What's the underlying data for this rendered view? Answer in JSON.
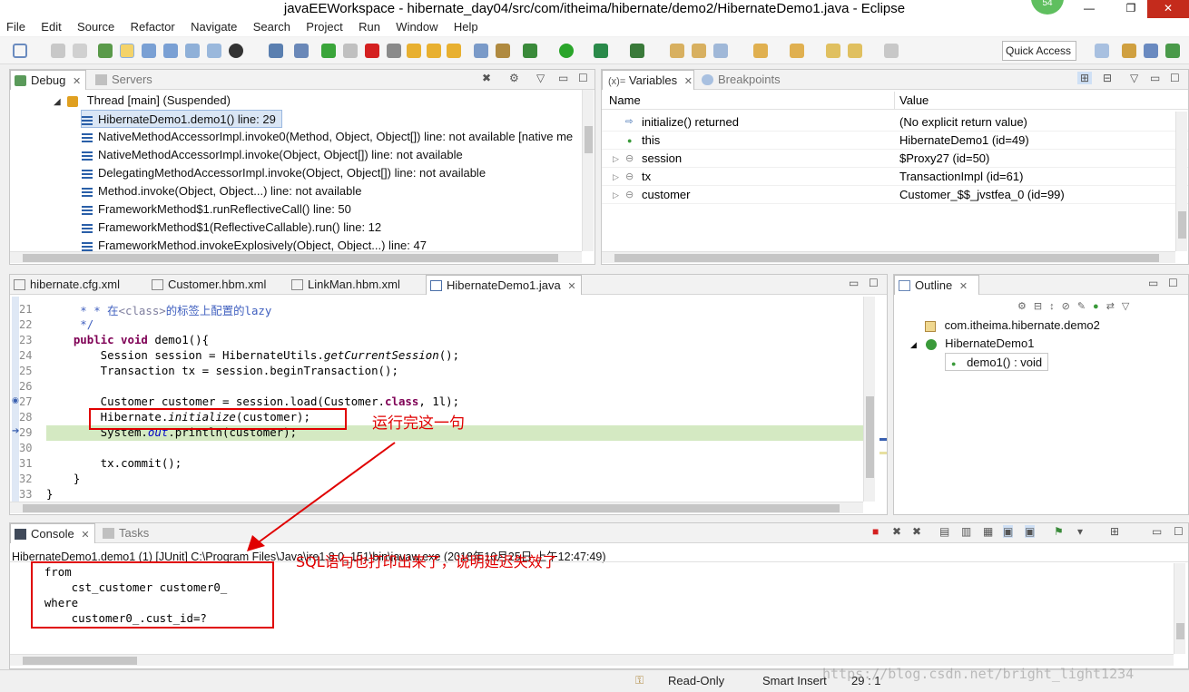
{
  "window": {
    "title": "javaEEWorkspace - hibernate_day04/src/com/itheima/hibernate/demo2/HibernateDemo1.java - Eclipse",
    "badge": "54",
    "minimize": "—",
    "restore": "❐",
    "close": "✕"
  },
  "menu": [
    "File",
    "Edit",
    "Source",
    "Refactor",
    "Navigate",
    "Search",
    "Project",
    "Run",
    "Window",
    "Help"
  ],
  "quick_access": {
    "label": "Quick Access"
  },
  "debug_panel": {
    "tabs": [
      {
        "label": "Debug",
        "active": true
      },
      {
        "label": "Servers",
        "active": false
      }
    ],
    "thread_label": "Thread [main] (Suspended)",
    "frames": [
      "HibernateDemo1.demo1() line: 29",
      "NativeMethodAccessorImpl.invoke0(Method, Object, Object[]) line: not available [native me",
      "NativeMethodAccessorImpl.invoke(Object, Object[]) line: not available",
      "DelegatingMethodAccessorImpl.invoke(Object, Object[]) line: not available",
      "Method.invoke(Object, Object...) line: not available",
      "FrameworkMethod$1.runReflectiveCall() line: 50",
      "FrameworkMethod$1(ReflectiveCallable).run() line: 12",
      "FrameworkMethod.invokeExplosively(Object, Object...) line: 47"
    ]
  },
  "variables_panel": {
    "tabs": [
      {
        "label": "Variables",
        "prefix": "(x)=",
        "active": true
      },
      {
        "label": "Breakpoints",
        "active": false
      }
    ],
    "columns": [
      "Name",
      "Value"
    ],
    "rows": [
      {
        "name": "initialize() returned",
        "value": "(No explicit return value)"
      },
      {
        "name": "this",
        "value": "HibernateDemo1  (id=49)"
      },
      {
        "name": "session",
        "value": "$Proxy27  (id=50)"
      },
      {
        "name": "tx",
        "value": "TransactionImpl  (id=61)"
      },
      {
        "name": "customer",
        "value": "Customer_$$_jvstfea_0  (id=99)"
      }
    ]
  },
  "editor": {
    "tabs": [
      {
        "label": "hibernate.cfg.xml",
        "active": false
      },
      {
        "label": "Customer.hbm.xml",
        "active": false
      },
      {
        "label": "LinkMan.hbm.xml",
        "active": false
      },
      {
        "label": "HibernateDemo1.java",
        "active": true
      }
    ],
    "line_numbers": [
      "21",
      "22",
      "23",
      "24",
      "25",
      "26",
      "27",
      "28",
      "29",
      "30",
      "31",
      "32",
      "33"
    ],
    "lines": {
      "l21a": "     * * 在",
      "l21b": "<class>",
      "l21c": "的标签上配置的",
      "l21d": "lazy",
      "l22": "     */",
      "l23a": "    public void",
      "l23b": " demo1(){",
      "l24a": "        Session ",
      "l24b": "session",
      "l24c": " = HibernateUtils.",
      "l24d": "getCurrentSession",
      "l24e": "();",
      "l25a": "        Transaction ",
      "l25b": "tx",
      "l25c": " = ",
      "l25d": "session",
      "l25e": ".beginTransaction();",
      "l27a": "        Customer ",
      "l27b": "customer",
      "l27c": " = ",
      "l27d": "session",
      "l27e": ".load(Customer.",
      "l27f": "class",
      "l27g": ", 1l);",
      "l28a": "        Hibernate.",
      "l28b": "initialize",
      "l28c": "(",
      "l28d": "customer",
      "l28e": ");",
      "l29a": "        System.",
      "l29b": "out",
      "l29c": ".println(",
      "l29d": "customer",
      "l29e": ");",
      "l31a": "        tx",
      "l31b": ".commit();",
      "l32": "    }",
      "l33": "}"
    }
  },
  "outline_panel": {
    "tab": "Outline",
    "package": "com.itheima.hibernate.demo2",
    "class": "HibernateDemo1",
    "method": "demo1() : void"
  },
  "console_panel": {
    "tabs": [
      {
        "label": "Console",
        "active": true
      },
      {
        "label": "Tasks",
        "active": false
      }
    ],
    "launch": "HibernateDemo1.demo1 (1) [JUnit] C:\\Program Files\\Java\\jre1.8.0_151\\bin\\javaw.exe (2018年10月25日 上午12:47:49)",
    "output": [
      "    from",
      "        cst_customer customer0_",
      "    where",
      "        customer0_.cust_id=?"
    ]
  },
  "status_bar": {
    "mode": "Read-Only",
    "insert": "Smart Insert",
    "position": "29 : 1"
  },
  "annotations": {
    "step": "运行完这一句",
    "sql": "SQL语句也打印出来了，说明延迟失效了"
  },
  "watermark": "https://blog.csdn.net/bright_light1234",
  "colors": {
    "annotation_red": "#e00000",
    "highlight_line": "#d4e9c2",
    "keyword": "#7f0055",
    "comment": "#3f5fbf",
    "field": "#0000c0"
  }
}
